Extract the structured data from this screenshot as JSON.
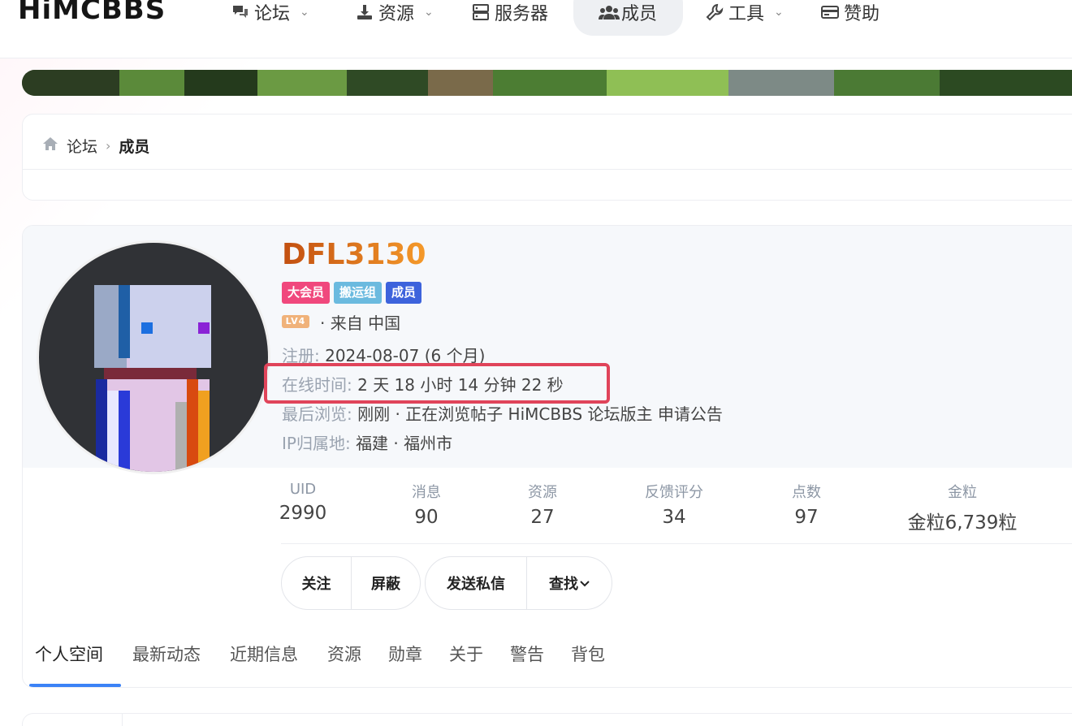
{
  "nav": {
    "logo": "HiMCBBS",
    "items": [
      {
        "label": "论坛",
        "icon": "chat-icon",
        "dropdown": true
      },
      {
        "label": "资源",
        "icon": "download-icon",
        "dropdown": true
      },
      {
        "label": "服务器",
        "icon": "server-icon",
        "dropdown": false
      },
      {
        "label": "成员",
        "icon": "users-icon",
        "dropdown": false,
        "active": true
      },
      {
        "label": "工具",
        "icon": "wrench-icon",
        "dropdown": true
      },
      {
        "label": "赞助",
        "icon": "card-icon",
        "dropdown": false
      }
    ]
  },
  "breadcrumb": {
    "home_icon": "home-icon",
    "items": [
      "论坛",
      "成员"
    ]
  },
  "profile": {
    "username": "DFL3130",
    "badges": [
      {
        "label": "大会员",
        "color": "#f0487d"
      },
      {
        "label": "搬运组",
        "color": "#6bbadf"
      },
      {
        "label": "成员",
        "color": "#3d63dc"
      }
    ],
    "level": "LV4",
    "from": "· 来自 中国",
    "register": {
      "key": "注册:",
      "value": "2024-08-07 (6 个月)"
    },
    "online": {
      "key": "在线时间:",
      "value": "2 天 18 小时 14 分钟 22 秒"
    },
    "last_seen": {
      "key": "最后浏览:",
      "value": "刚刚 · 正在浏览帖子 HiMCBBS 论坛版主 申请公告"
    },
    "ip": {
      "key": "IP归属地:",
      "value": "福建 · 福州市"
    }
  },
  "stats": [
    {
      "label": "UID",
      "value": "2990"
    },
    {
      "label": "消息",
      "value": "90"
    },
    {
      "label": "资源",
      "value": "27"
    },
    {
      "label": "反馈评分",
      "value": "34"
    },
    {
      "label": "点数",
      "value": "97"
    },
    {
      "label": "金粒",
      "value": "金粒6,739粒"
    }
  ],
  "actions": {
    "follow": "关注",
    "block": "屏蔽",
    "message": "发送私信",
    "find": "查找"
  },
  "tabs": [
    "个人空间",
    "最新动态",
    "近期信息",
    "资源",
    "勋章",
    "关于",
    "警告",
    "背包"
  ],
  "colors": {
    "accent": "#3b82f6",
    "highlight": "#e0445a"
  }
}
